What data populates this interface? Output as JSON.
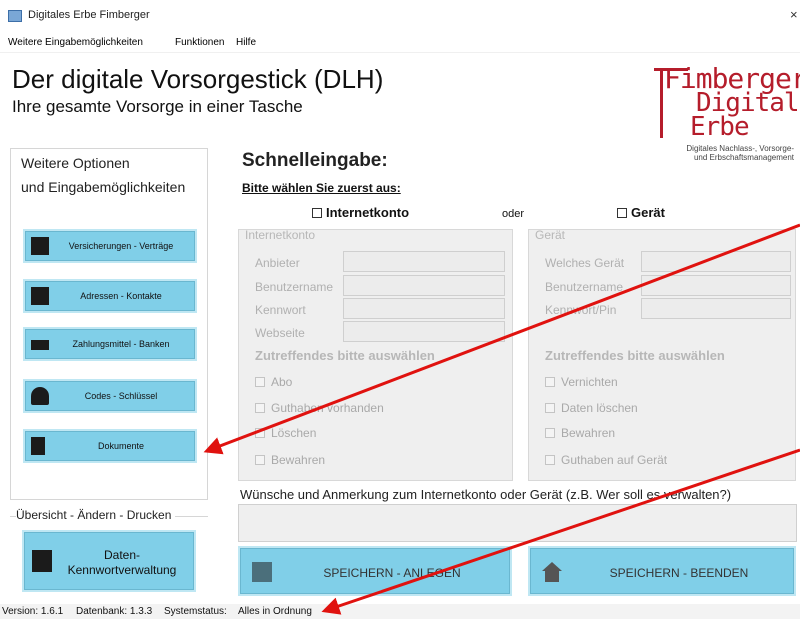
{
  "window": {
    "title": "Digitales Erbe Fimberger",
    "close_glyph": "×"
  },
  "menu": [
    "Weitere Eingabemöglichkeiten",
    "Funktionen",
    "Hilfe"
  ],
  "header": {
    "title": "Der digitale Vorsorgestick (DLH)",
    "subtitle": "Ihre gesamte Vorsorge in einer Tasche"
  },
  "logo": {
    "line1": "Fimberger",
    "line2": "Digitales",
    "line3": "Erbe",
    "tagline1": "Digitales Nachlass-, Vorsorge-",
    "tagline2": "und Erbschaftsmanagement",
    "color": "#b51d2b"
  },
  "left_panel": {
    "header1": "Weitere Optionen",
    "header2": "und Eingabemöglichkeiten",
    "buttons": [
      {
        "label": "Versicherungen - Verträge",
        "icon": "dollar-icon"
      },
      {
        "label": "Adressen - Kontakte",
        "icon": "contacts-icon"
      },
      {
        "label": "Zahlungsmittel - Banken",
        "icon": "credit-card-icon"
      },
      {
        "label": "Codes - Schlüssel",
        "icon": "key-icon"
      },
      {
        "label": "Dokumente",
        "icon": "document-icon"
      }
    ]
  },
  "overview": {
    "legend": "Übersicht - Ändern - Drucken",
    "button_line1": "Daten-",
    "button_line2": "Kennwortverwaltung"
  },
  "quick_entry": {
    "title": "Schnelleingabe:",
    "prompt": "Bitte wählen Sie zuerst aus:",
    "option_internet": "Internetkonto",
    "or": "oder",
    "option_device": "Gerät"
  },
  "internet_group": {
    "title": "Internetkonto",
    "fields": [
      "Anbieter",
      "Benutzername",
      "Kennwort",
      "Webseite"
    ],
    "section": "Zutreffendes bitte auswählen",
    "checks": [
      "Abo",
      "Guthaben vorhanden",
      "Löschen",
      "Bewahren"
    ]
  },
  "device_group": {
    "title": "Gerät",
    "fields": [
      "Welches Gerät",
      "Benutzername",
      "Kennwort/Pin"
    ],
    "section": "Zutreffendes bitte auswählen",
    "checks": [
      "Vernichten",
      "Daten löschen",
      "Bewahren",
      "Guthaben auf Gerät"
    ]
  },
  "wishes": {
    "label": "Wünsche und Anmerkung zum Internetkonto oder Gerät (z.B. Wer soll es verwalten?)"
  },
  "actions": {
    "save_create": "SPEICHERN - ANLEGEN",
    "save_exit": "SPEICHERN - BEENDEN"
  },
  "status": {
    "version": "Version: 1.6.1",
    "database": "Datenbank: 1.3.3",
    "system": "Systemstatus:",
    "system_value": "Alles in Ordnung"
  },
  "colors": {
    "button": "#80cfe8",
    "annotation_arrow": "#e0120f"
  }
}
